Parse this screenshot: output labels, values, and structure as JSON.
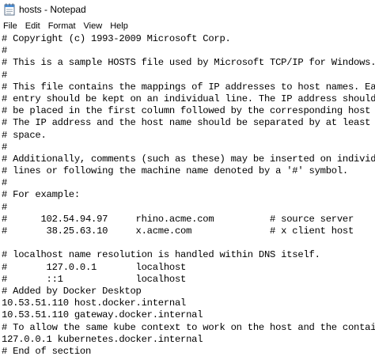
{
  "window": {
    "title": "hosts - Notepad",
    "icon": "notepad-icon"
  },
  "menu": {
    "items": [
      "File",
      "Edit",
      "Format",
      "View",
      "Help"
    ]
  },
  "editor": {
    "lines": [
      "# Copyright (c) 1993-2009 Microsoft Corp.",
      "#",
      "# This is a sample HOSTS file used by Microsoft TCP/IP for Windows.",
      "#",
      "# This file contains the mappings of IP addresses to host names. Each",
      "# entry should be kept on an individual line. The IP address should",
      "# be placed in the first column followed by the corresponding host name.",
      "# The IP address and the host name should be separated by at least one",
      "# space.",
      "#",
      "# Additionally, comments (such as these) may be inserted on individual",
      "# lines or following the machine name denoted by a '#' symbol.",
      "#",
      "# For example:",
      "#",
      "#      102.54.94.97     rhino.acme.com          # source server",
      "#       38.25.63.10     x.acme.com              # x client host",
      "",
      "# localhost name resolution is handled within DNS itself.",
      "#\t127.0.0.1       localhost",
      "#\t::1             localhost",
      "# Added by Docker Desktop",
      "10.53.51.110 host.docker.internal",
      "10.53.51.110 gateway.docker.internal",
      "# To allow the same kube context to work on the host and the container:",
      "127.0.0.1 kubernetes.docker.internal",
      "# End of section"
    ]
  }
}
